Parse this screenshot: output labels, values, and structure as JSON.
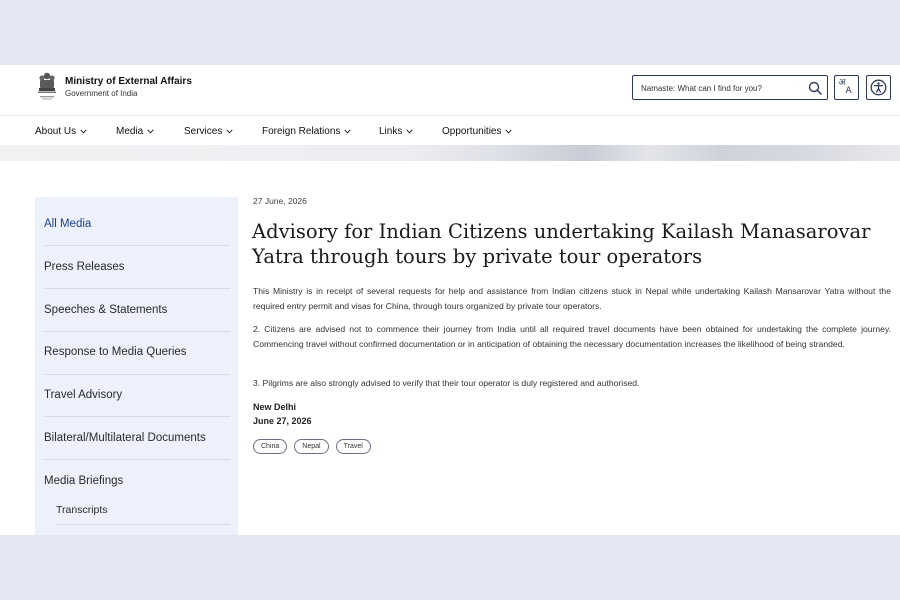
{
  "header": {
    "title": "Ministry of External Affairs",
    "subtitle": "Government of India",
    "search_placeholder": "Namaste: What can I find for you?",
    "lang_glyph_1": "अ",
    "lang_glyph_2": "A"
  },
  "nav": {
    "items": [
      {
        "label": "About Us"
      },
      {
        "label": "Media"
      },
      {
        "label": "Services"
      },
      {
        "label": "Foreign Relations"
      },
      {
        "label": "Links"
      },
      {
        "label": "Opportunities"
      }
    ]
  },
  "sidebar": {
    "items": [
      {
        "label": "All Media",
        "active": true
      },
      {
        "label": "Press Releases"
      },
      {
        "label": "Speeches & Statements"
      },
      {
        "label": "Response to Media Queries"
      },
      {
        "label": "Travel Advisory"
      },
      {
        "label": "Bilateral/Multilateral Documents"
      },
      {
        "label": "Media Briefings"
      }
    ],
    "sub_items": [
      {
        "label": "Transcripts"
      }
    ]
  },
  "article": {
    "date": "27 June, 2026",
    "title": "Advisory for Indian Citizens undertaking Kailash Manasarovar Yatra through tours by private tour operators",
    "paragraphs": [
      "This Ministry is in receipt of several requests for help and assistance from Indian citizens stuck in Nepal while undertaking Kailash Mansarovar Yatra without the required entry permit and visas for China, through tours organized by private tour operators.",
      "2. Citizens are advised not to commence their journey from India until all required travel documents have been obtained for undertaking the complete journey. Commencing travel without confirmed documentation or in anticipation of obtaining the necessary documentation increases the likelihood of being stranded.",
      "3. Pilgrims are also strongly advised to verify that their tour operator is duly registered and authorised."
    ],
    "place": "New Delhi",
    "place_date": "June 27, 2026",
    "tags": [
      "China",
      "Nepal",
      "Travel"
    ]
  },
  "colors": {
    "accent": "#1e3f8f",
    "sidebar_bg": "#edf1fb",
    "page_bg": "#e4e7f2"
  }
}
